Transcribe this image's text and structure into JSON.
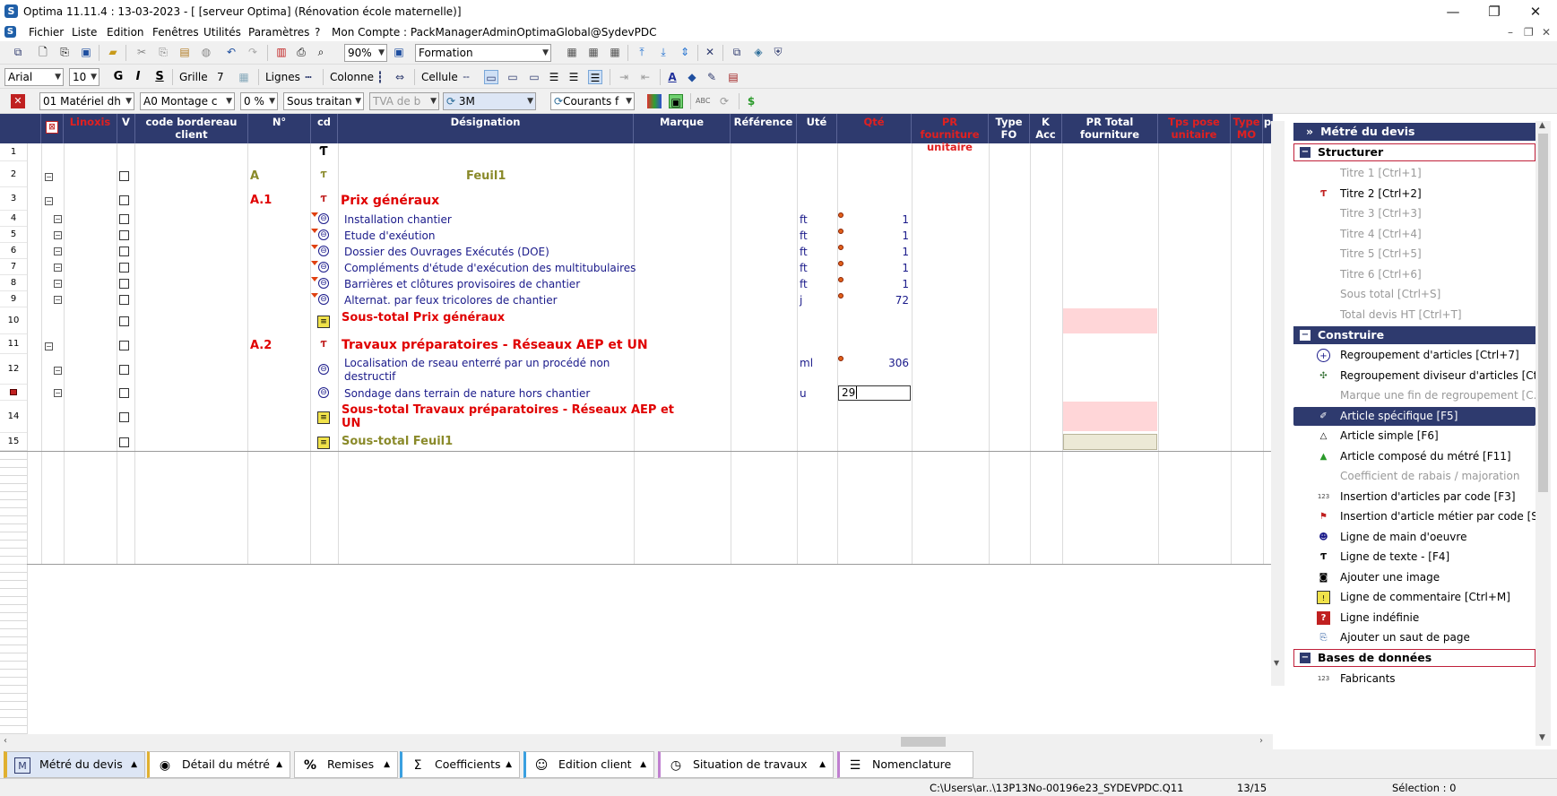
{
  "window": {
    "title": "Optima 11.11.4 : 13-03-2023 - [ [serveur Optima] (Rénovation école maternelle)]",
    "controls": [
      "—",
      "❐",
      "✕"
    ]
  },
  "menu": {
    "items": [
      "Fichier",
      "Liste",
      "Edition",
      "Fenêtres",
      "Utilités",
      "Paramètres",
      "?",
      "Mon Compte : PackManagerAdminOptimaGlobal@SydevPDC"
    ],
    "mdi_controls": [
      "–",
      "❐",
      "✕"
    ]
  },
  "toolbar1": {
    "zoom": "90%",
    "view": "Formation"
  },
  "toolbar2": {
    "font": "Arial",
    "font_size": "10",
    "bold": "G",
    "italic": "I",
    "strike": "S",
    "grid_label": "Grille",
    "grid_value": "7",
    "lines_label": "Lignes",
    "columns_label": "Colonne",
    "cell_label": "Cellule"
  },
  "toolbar3": {
    "combo_materiel": "01  Matériel dh",
    "combo_montage": "A0  Montage c",
    "combo_pct": "0 %",
    "combo_sous": "Sous traitan",
    "combo_tva": "TVA de b",
    "combo_3m": "3M",
    "combo_courants": "Courants f"
  },
  "grid": {
    "headers": [
      {
        "key": "linoxis",
        "label": "Linoxis",
        "red": true
      },
      {
        "key": "v",
        "label": "V",
        "red": false
      },
      {
        "key": "code",
        "label": "code bordereau client",
        "red": false
      },
      {
        "key": "n",
        "label": "N°",
        "red": false
      },
      {
        "key": "cd",
        "label": "cd",
        "red": false
      },
      {
        "key": "designation",
        "label": "Désignation",
        "red": false
      },
      {
        "key": "marque",
        "label": "Marque",
        "red": false
      },
      {
        "key": "reference",
        "label": "Référence",
        "red": false
      },
      {
        "key": "ute",
        "label": "Uté",
        "red": false
      },
      {
        "key": "qte",
        "label": "Qté",
        "red": true
      },
      {
        "key": "pr_four",
        "label": "PR fourniture unitaire",
        "red": true
      },
      {
        "key": "type_fo",
        "label": "Type FO",
        "red": false
      },
      {
        "key": "k_acc",
        "label": "K Acc",
        "red": false
      },
      {
        "key": "pr_total",
        "label": "PR Total fourniture",
        "red": false
      },
      {
        "key": "tps_pose",
        "label": "Tps pose unitaire",
        "red": true
      },
      {
        "key": "type_mo",
        "label": "Type MO",
        "red": true
      },
      {
        "key": "p",
        "label": "p",
        "red": false
      }
    ],
    "rows": [
      {
        "num": "1",
        "n": "",
        "designation": "",
        "ute": "",
        "qty": "",
        "kind": "text"
      },
      {
        "num": "2",
        "n": "A",
        "designation": "Feuil1",
        "ute": "",
        "qty": "",
        "kind": "title1"
      },
      {
        "num": "3",
        "n": "A.1",
        "designation": "Prix généraux",
        "ute": "",
        "qty": "",
        "kind": "title2"
      },
      {
        "num": "4",
        "n": "",
        "designation": "Installation chantier",
        "ute": "ft",
        "qty": "1",
        "kind": "article"
      },
      {
        "num": "5",
        "n": "",
        "designation": "Etude d'exéution",
        "ute": "ft",
        "qty": "1",
        "kind": "article"
      },
      {
        "num": "6",
        "n": "",
        "designation": "Dossier des Ouvrages Exécutés (DOE)",
        "ute": "ft",
        "qty": "1",
        "kind": "article"
      },
      {
        "num": "7",
        "n": "",
        "designation": "Compléments d'étude d'exécution des multitubulaires",
        "ute": "ft",
        "qty": "1",
        "kind": "article"
      },
      {
        "num": "8",
        "n": "",
        "designation": "Barrières et clôtures provisoires de chantier",
        "ute": "ft",
        "qty": "1",
        "kind": "article"
      },
      {
        "num": "9",
        "n": "",
        "designation": "Alternat. par feux tricolores de chantier",
        "ute": "j",
        "qty": "72",
        "kind": "article"
      },
      {
        "num": "10",
        "n": "",
        "designation": "Sous-total Prix généraux",
        "ute": "",
        "qty": "",
        "kind": "subtotal"
      },
      {
        "num": "11",
        "n": "A.2",
        "designation": "Travaux préparatoires - Réseaux AEP et UN",
        "ute": "",
        "qty": "",
        "kind": "title2"
      },
      {
        "num": "12",
        "n": "",
        "designation": "Localisation de rseau enterré par un procédé non",
        "designation2": "destructif",
        "ute": "ml",
        "qty": "306",
        "kind": "article"
      },
      {
        "num": "",
        "n": "",
        "designation": "Sondage dans terrain de nature hors chantier",
        "ute": "u",
        "qty": "29",
        "kind": "article-edit"
      },
      {
        "num": "14",
        "n": "",
        "designation": "Sous-total Travaux préparatoires - Réseaux AEP et",
        "designation2": "UN",
        "ute": "",
        "qty": "",
        "kind": "subtotal"
      },
      {
        "num": "15",
        "n": "",
        "designation": "Sous-total Feuil1",
        "ute": "",
        "qty": "",
        "kind": "subtotal1"
      }
    ]
  },
  "panel": {
    "title": "Métré du devis",
    "sections": [
      {
        "label": "Structurer",
        "items": [
          {
            "label": "Titre 1 [Ctrl+1]",
            "enabled": false,
            "icon": ""
          },
          {
            "label": "Titre 2 [Ctrl+2]",
            "enabled": true,
            "icon": "title2-icon"
          },
          {
            "label": "Titre 3 [Ctrl+3]",
            "enabled": false,
            "icon": ""
          },
          {
            "label": "Titre 4 [Ctrl+4]",
            "enabled": false,
            "icon": ""
          },
          {
            "label": "Titre 5 [Ctrl+5]",
            "enabled": false,
            "icon": ""
          },
          {
            "label": "Titre 6 [Ctrl+6]",
            "enabled": false,
            "icon": ""
          },
          {
            "label": "Sous total [Ctrl+S]",
            "enabled": false,
            "icon": ""
          },
          {
            "label": "Total devis HT [Ctrl+T]",
            "enabled": false,
            "icon": ""
          }
        ]
      },
      {
        "label": "Construire",
        "items": [
          {
            "label": "Regroupement d'articles  [Ctrl+7]",
            "enabled": true,
            "icon": "group-icon"
          },
          {
            "label": "Regroupement diviseur d'articles [Ctr...",
            "enabled": true,
            "icon": "group-divider-icon"
          },
          {
            "label": "Marque une fin de regroupement   [C...",
            "enabled": false,
            "icon": ""
          },
          {
            "label": "Article spécifique [F5]",
            "enabled": true,
            "icon": "specific-article-icon",
            "selected": true
          },
          {
            "label": "Article simple [F6]",
            "enabled": true,
            "icon": "simple-article-icon"
          },
          {
            "label": "Article composé du métré [F11]",
            "enabled": true,
            "icon": "composite-article-icon"
          },
          {
            "label": "Coefficient de rabais / majoration",
            "enabled": false,
            "icon": ""
          },
          {
            "label": "Insertion d'articles par code [F3]",
            "enabled": true,
            "icon": "insert-code-icon"
          },
          {
            "label": "Insertion d'article métier par code [S...",
            "enabled": true,
            "icon": "insert-trade-icon"
          },
          {
            "label": "Ligne de main d'oeuvre",
            "enabled": true,
            "icon": "labor-icon"
          },
          {
            "label": "Ligne de texte - [F4]",
            "enabled": true,
            "icon": "text-line-icon"
          },
          {
            "label": "Ajouter une image",
            "enabled": true,
            "icon": "camera-icon"
          },
          {
            "label": "Ligne de commentaire [Ctrl+M]",
            "enabled": true,
            "icon": "comment-icon"
          },
          {
            "label": "Ligne indéfinie",
            "enabled": true,
            "icon": "question-icon"
          },
          {
            "label": "Ajouter un saut de page",
            "enabled": true,
            "icon": "page-break-icon"
          }
        ]
      },
      {
        "label": "Bases de données",
        "items": [
          {
            "label": "Fabricants",
            "enabled": true,
            "icon": "manufacturers-icon"
          }
        ]
      }
    ]
  },
  "tabs": [
    {
      "label": "Métré du devis",
      "icon": "M"
    },
    {
      "label": "Détail du métré",
      "icon": "◉"
    },
    {
      "label": "Remises",
      "icon": "%"
    },
    {
      "label": "Coefficients",
      "icon": "Σ"
    },
    {
      "label": "Edition client",
      "icon": "☺"
    },
    {
      "label": "Situation de travaux",
      "icon": "◷"
    },
    {
      "label": "Nomenclature",
      "icon": "☰"
    }
  ],
  "status": {
    "path": "C:\\Users\\ar..\\13P13No-00196e23_SYDEVPDC.Q11",
    "position": "13/15",
    "selection": "Sélection : 0"
  },
  "colors": {
    "header_bg": "#2e3a6e",
    "title_red": "#e00000",
    "feuil_olive": "#8a8a2a",
    "subtotal_red": "#e00000",
    "article_blue": "#1a1a8a",
    "pink_cell": "#ffd6d8"
  }
}
